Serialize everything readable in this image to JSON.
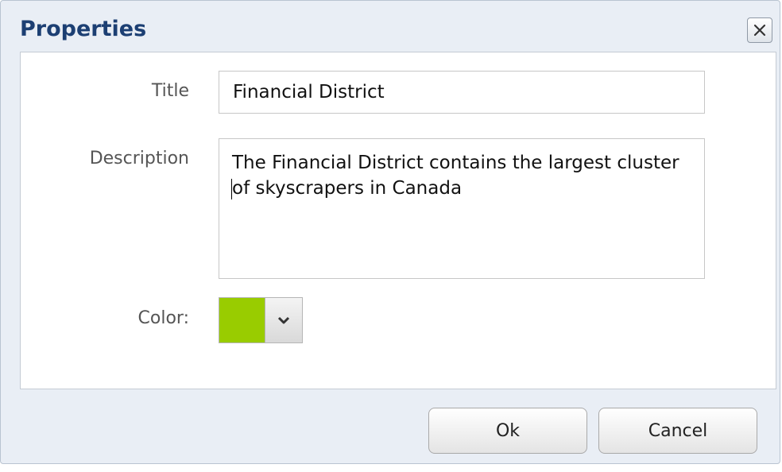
{
  "dialog": {
    "title": "Properties",
    "close_icon": "close-icon"
  },
  "form": {
    "title_label": "Title",
    "title_value": "Financial District",
    "description_label": "Description",
    "description_value": "The Financial District contains the largest cluster of skyscrapers in Canada",
    "color_label": "Color:",
    "color_value": "#99cc00",
    "color_dropdown_icon": "chevron-down-icon"
  },
  "buttons": {
    "ok_label": "Ok",
    "cancel_label": "Cancel"
  }
}
